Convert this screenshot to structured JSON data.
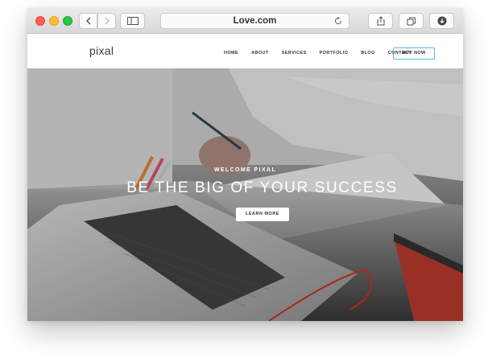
{
  "browser": {
    "address": "Love.com"
  },
  "site": {
    "logo": "pixal",
    "nav": [
      "HOME",
      "ABOUT",
      "SERVICES",
      "PORTFOLIO",
      "BLOG",
      "CONTACT"
    ],
    "cta": "BUY NOW"
  },
  "hero": {
    "kicker": "WELCOME PIXAL",
    "title": "BE THE BIG OF YOUR SUCCESS",
    "button": "LEARN MORE"
  },
  "colors": {
    "accent": "#5ab6e6",
    "close": "#fc5f57",
    "minimize": "#fdbd2e",
    "zoom": "#28c840"
  }
}
